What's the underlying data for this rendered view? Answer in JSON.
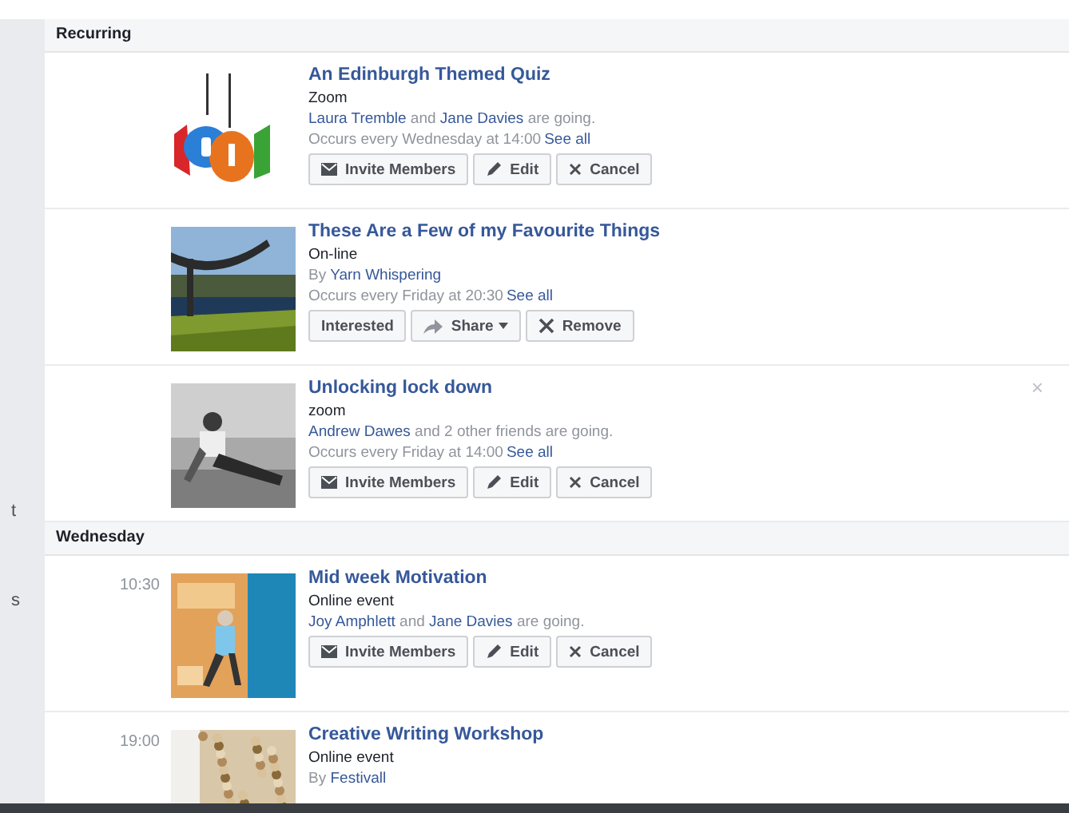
{
  "sidebar_fragments": [
    "t",
    "s"
  ],
  "sections": [
    {
      "heading": "Recurring",
      "events": [
        {
          "title": "An Edinburgh Themed Quiz",
          "location": "Zoom",
          "people": [
            {
              "text": "Laura Tremble",
              "link": true
            },
            {
              "text": " and ",
              "link": false
            },
            {
              "text": "Jane Davies",
              "link": true
            },
            {
              "text": " are going.",
              "link": false
            }
          ],
          "occurs": "Occurs every Wednesday at 14:00",
          "see_all": "See all",
          "buttons": [
            {
              "label": "Invite Members",
              "kind": "invite"
            },
            {
              "label": "Edit",
              "kind": "edit"
            },
            {
              "label": "Cancel",
              "kind": "cancel"
            }
          ],
          "dismiss": false
        },
        {
          "title": "These Are a Few of my Favourite Things",
          "location": "On-line",
          "people": [
            {
              "text": "By ",
              "link": false
            },
            {
              "text": "Yarn Whispering",
              "link": true
            }
          ],
          "occurs": "Occurs every Friday at 20:30",
          "see_all": "See all",
          "buttons": [
            {
              "label": "Interested",
              "kind": "plain"
            },
            {
              "label": "Share",
              "kind": "share",
              "caret": true
            },
            {
              "label": "Remove",
              "kind": "remove"
            }
          ],
          "dismiss": false
        },
        {
          "title": "Unlocking lock down",
          "location": "zoom",
          "people": [
            {
              "text": "Andrew Dawes",
              "link": true
            },
            {
              "text": " and 2 other friends are going.",
              "link": false
            }
          ],
          "occurs": "Occurs every Friday at 14:00",
          "see_all": "See all",
          "buttons": [
            {
              "label": "Invite Members",
              "kind": "invite"
            },
            {
              "label": "Edit",
              "kind": "edit"
            },
            {
              "label": "Cancel",
              "kind": "cancel"
            }
          ],
          "dismiss": true,
          "dismiss_label": "×"
        }
      ]
    },
    {
      "heading": "Wednesday",
      "events": [
        {
          "time": "10:30",
          "title": "Mid week Motivation",
          "location": "Online event",
          "people": [
            {
              "text": "Joy Amphlett",
              "link": true
            },
            {
              "text": " and ",
              "link": false
            },
            {
              "text": "Jane Davies",
              "link": true
            },
            {
              "text": " are going.",
              "link": false
            }
          ],
          "buttons": [
            {
              "label": "Invite Members",
              "kind": "invite"
            },
            {
              "label": "Edit",
              "kind": "edit"
            },
            {
              "label": "Cancel",
              "kind": "cancel"
            }
          ],
          "dismiss": false
        },
        {
          "time": "19:00",
          "title": "Creative Writing Workshop",
          "location": "Online event",
          "people": [
            {
              "text": "By ",
              "link": false
            },
            {
              "text": "Festivall",
              "link": true
            }
          ],
          "dismiss": false
        }
      ]
    }
  ]
}
